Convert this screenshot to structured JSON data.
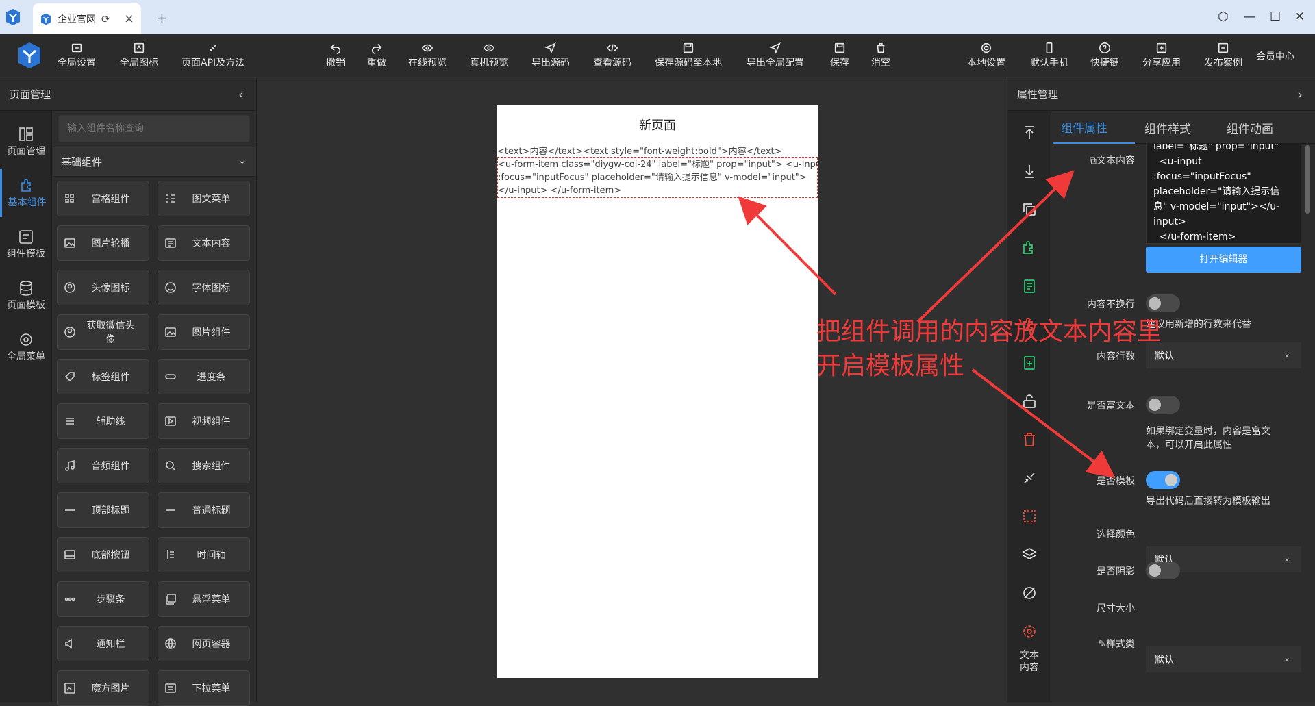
{
  "browser": {
    "tab_title": "企业官网",
    "reload_icon": "reload-icon",
    "close_icon": "close-icon",
    "new_tab": "+",
    "window_controls": [
      "settings-icon",
      "minimize-icon",
      "maximize-icon",
      "close-icon"
    ]
  },
  "toolbar": {
    "left": [
      "全局设置",
      "全局图标",
      "页面API及方法"
    ],
    "center": [
      "撤销",
      "重做",
      "在线预览",
      "真机预览",
      "导出源码",
      "查看源码",
      "保存源码至本地",
      "导出全局配置",
      "保存",
      "消空"
    ],
    "right": [
      "本地设置",
      "默认手机",
      "快捷键",
      "分享应用",
      "发布案例"
    ],
    "member": "会员中心"
  },
  "left_panel": {
    "title": "页面管理",
    "nav": [
      "页面管理",
      "基本组件",
      "组件模板",
      "页面模板",
      "全局菜单"
    ],
    "search_placeholder": "输入组件名称查询",
    "category": "基础组件",
    "components": [
      "宫格组件",
      "图文菜单",
      "图片轮播",
      "文本内容",
      "头像图标",
      "字体图标",
      "获取微信头像",
      "图片组件",
      "标签组件",
      "进度条",
      "辅助线",
      "视频组件",
      "音频组件",
      "搜索组件",
      "顶部标题",
      "普通标题",
      "底部按钮",
      "时间轴",
      "步骤条",
      "悬浮菜单",
      "通知栏",
      "网页容器",
      "魔方图片",
      "下拉菜单"
    ]
  },
  "canvas": {
    "page_title": "新页面",
    "line1": "<text>内容</text><text style=\"font-weight:bold\">内容</text>",
    "box_line1": "<u-form-item class=\"diygw-col-24\" label=\"标题\" prop=\"input\"> <u-input",
    "box_line2": ":focus=\"inputFocus\" placeholder=\"请输入提示信息\" v-model=\"input\">",
    "box_line3": "</u-input> </u-form-item>"
  },
  "right_panel": {
    "title": "属性管理",
    "tabs": [
      "组件属性",
      "组件样式",
      "组件动画"
    ],
    "tool_label": "文本\n内容",
    "props": {
      "text_content_label": "文本内容",
      "code_lines": [
        "label=\"标题\" prop=\"input\"",
        "  <u-input",
        ":focus=\"inputFocus\"",
        "placeholder=\"请输入提示信",
        "息\" v-model=\"input\"></u-",
        "input>",
        "  </u-form-item>"
      ],
      "open_editor": "打开编辑器",
      "nowrap_label": "内容不换行",
      "nowrap_hint": "建议用新增的行数来代替",
      "lines_label": "内容行数",
      "lines_value": "默认",
      "richtext_label": "是否富文本",
      "richtext_hint": "如果绑定变量时，内容是富文本，可以开启此属性",
      "template_label": "是否模板",
      "template_hint": "导出代码后直接转为模板输出",
      "color_label": "选择颜色",
      "color_value": "默认",
      "shadow_label": "是否阴影",
      "size_label": "尺寸大小",
      "size_value": "默认",
      "class_label": "样式类"
    }
  },
  "annotation": {
    "line1": "把组件调用的内容放文本内容里",
    "line2": "开启模板属性",
    "color": "#f03a3a"
  }
}
